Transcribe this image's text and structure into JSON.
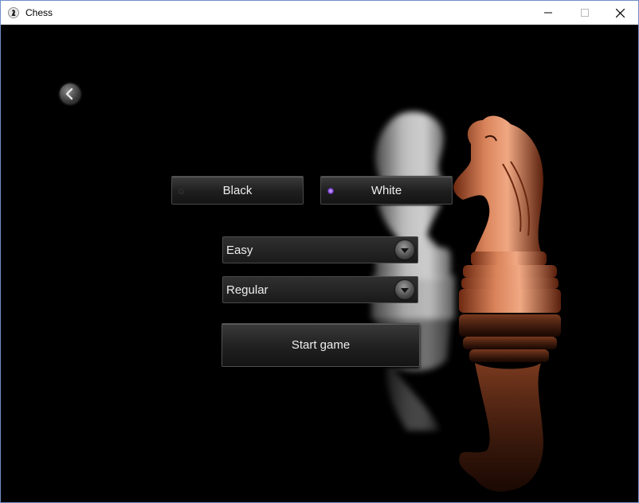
{
  "window": {
    "title": "Chess",
    "controls": [
      "minimize",
      "maximize",
      "close"
    ]
  },
  "nav": {
    "back_icon": "chevron-left-icon"
  },
  "color_choice": {
    "options": [
      {
        "label": "Black",
        "selected": false
      },
      {
        "label": "White",
        "selected": true
      }
    ],
    "selected_color": "#9b5cf0"
  },
  "difficulty": {
    "value": "Easy"
  },
  "mode": {
    "value": "Regular"
  },
  "start": {
    "label": "Start game"
  },
  "artwork": {
    "description_icon": "knight-pieces-icon"
  }
}
